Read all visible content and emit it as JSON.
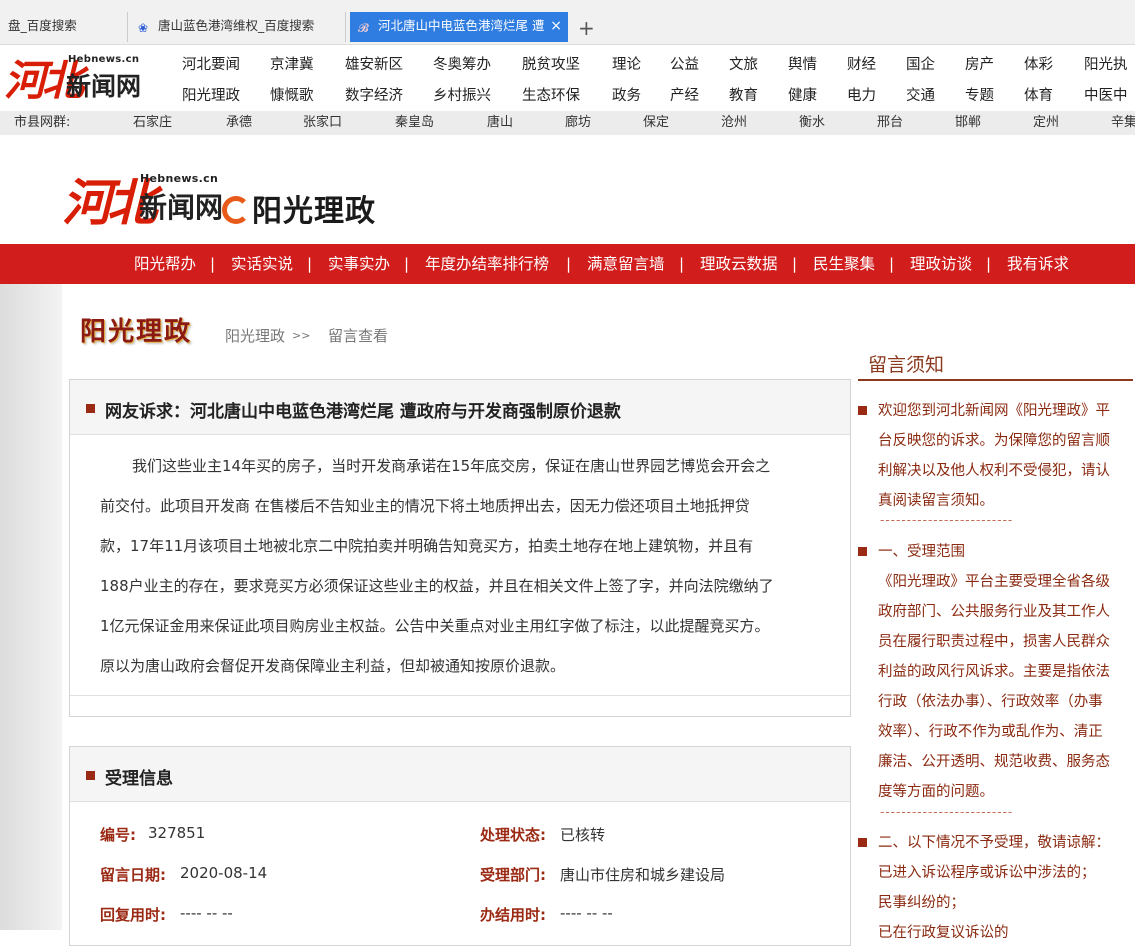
{
  "browser": {
    "tabs": [
      {
        "label": "盘_百度搜索",
        "active": false
      },
      {
        "label": "唐山蓝色港湾维权_百度搜索",
        "active": false
      },
      {
        "label": "河北唐山中电蓝色港湾烂尾 遭",
        "active": true
      }
    ],
    "close_glyph": "×",
    "newtab_glyph": "+"
  },
  "site": {
    "logo_mark": "河北",
    "logo_text": "新闻网",
    "logo_domain": "Hebnews.cn",
    "nav_row1": [
      "河北要闻",
      "京津冀",
      "雄安新区",
      "冬奥筹办",
      "脱贫攻坚",
      "理论",
      "公益",
      "文旅",
      "舆情",
      "财经",
      "国企",
      "房产",
      "体彩",
      "阳光执"
    ],
    "nav_row2": [
      "阳光理政",
      "慷慨歌",
      "数字经济",
      "乡村振兴",
      "生态环保",
      "政务",
      "产经",
      "教育",
      "健康",
      "电力",
      "交通",
      "专题",
      "体育",
      "中医中"
    ],
    "city_label": "市县网群:",
    "cities": [
      "石家庄",
      "承德",
      "张家口",
      "秦皇岛",
      "唐山",
      "廊坊",
      "保定",
      "沧州",
      "衡水",
      "邢台",
      "邯郸",
      "定州",
      "辛集"
    ]
  },
  "channel": {
    "logo_mark": "河北",
    "logo_text": "新闻网",
    "logo_domain": "Hebnews.cn",
    "title": "阳光理政",
    "nav": [
      "阳光帮办",
      "实话实说",
      "实事实办",
      "年度办结率排行榜",
      "满意留言墙",
      "理政云数据",
      "民生聚集",
      "理政访谈",
      "我有诉求"
    ],
    "nav_separator": "|"
  },
  "breadcrumb": {
    "section_logo": "阳光理政",
    "home": "阳光理政",
    "separator": ">>",
    "current": "留言查看"
  },
  "complaint": {
    "title": "网友诉求：河北唐山中电蓝色港湾烂尾 遭政府与开发商强制原价退款",
    "lines": [
      "我们这些业主14年买的房子，当时开发商承诺在15年底交房，保证在唐山世界园艺博览会开会之",
      "前交付。此项目开发商 在售楼后不告知业主的情况下将土地质押出去，因无力偿还项目土地抵押贷",
      "款，17年11月该项目土地被北京二中院拍卖并明确告知竞买方，拍卖土地存在地上建筑物，并且有",
      "188户业主的存在，要求竞买方必须保证这些业主的权益，并且在相关文件上签了字，并向法院缴纳了",
      "1亿元保证金用来保证此项目购房业主权益。公告中关重点对业主用红字做了标注，以此提醒竞买方。",
      "原以为唐山政府会督促开发商保障业主利益，但却被通知按原价退款。"
    ]
  },
  "acceptance": {
    "title": "受理信息",
    "fields": [
      {
        "label": "编号:",
        "value": "327851"
      },
      {
        "label": "处理状态:",
        "value": "已核转"
      },
      {
        "label": "留言日期:",
        "value": "2020-08-14"
      },
      {
        "label": "受理部门:",
        "value": "唐山市住房和城乡建设局"
      },
      {
        "label": "回复用时:",
        "value": "---- -- --"
      },
      {
        "label": "办结用时:",
        "value": "---- -- --"
      }
    ]
  },
  "notice": {
    "title": "留言须知",
    "dash": "-------------------------",
    "items": [
      [
        "欢迎您到河北新闻网《阳光理政》平",
        "台反映您的诉求。为保障您的留言顺",
        "利解决以及他人权利不受侵犯，请认",
        "真阅读留言须知。"
      ],
      [
        "一、受理范围",
        "《阳光理政》平台主要受理全省各级",
        "政府部门、公共服务行业及其工作人",
        "员在履行职责过程中，损害人民群众",
        "利益的政风行风诉求。主要是指依法",
        "行政（依法办事）、行政效率（办事",
        "效率）、行政不作为或乱作为、清正",
        "廉洁、公开透明、规范收费、服务态",
        "度等方面的问题。"
      ],
      [
        "二、以下情况不予受理，敬请谅解：",
        "已进入诉讼程序或诉讼中涉法的；",
        "民事纠纷的；",
        "已在行政复议诉讼的"
      ]
    ]
  },
  "colors": {
    "red_nav": "#d21d1d",
    "accent_brown": "#9b2a14",
    "tab_active": "#2f7de1"
  }
}
